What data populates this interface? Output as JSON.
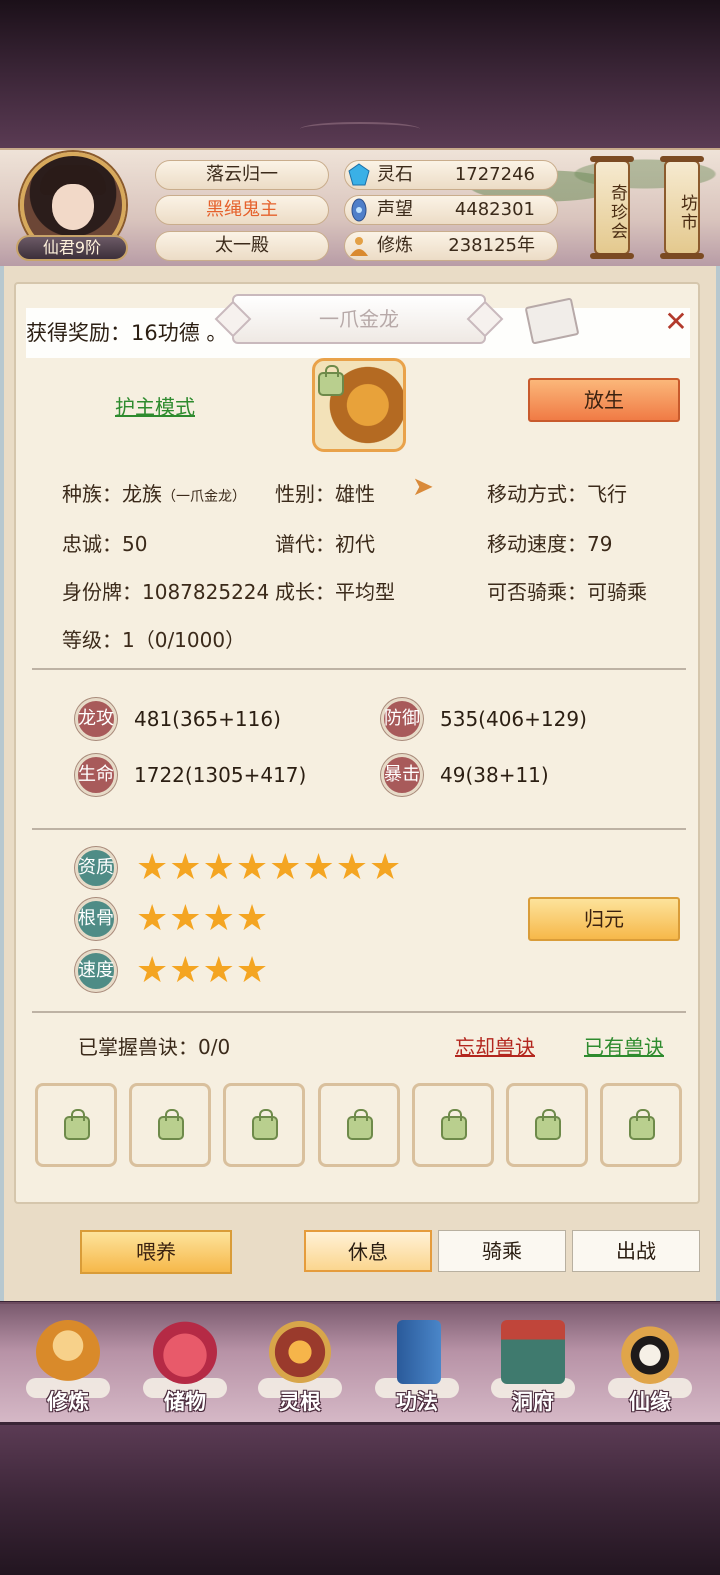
{
  "header": {
    "rank_badge": "仙君9阶",
    "names": [
      "落云归一",
      "黑绳鬼主",
      "太一殿"
    ],
    "resources": [
      {
        "icon": "spirit-stone-icon",
        "label": "灵石",
        "value": "1727246"
      },
      {
        "icon": "prestige-icon",
        "label": "声望",
        "value": "4482301"
      },
      {
        "icon": "cultivation-icon",
        "label": "修炼",
        "value": "238125年"
      }
    ],
    "scroll_buttons": [
      "奇珍会",
      "坊市"
    ]
  },
  "panel": {
    "title": "一爪金龙",
    "reward_text": "获得奖励：16功德 。",
    "guard_mode": "护主模式",
    "release_button": "放生",
    "info": {
      "race_label": "种族：",
      "race_value": "龙族",
      "race_sub": "（一爪金龙）",
      "gender": "性别：雄性",
      "move_mode": "移动方式：飞行",
      "loyalty": "忠诚：50",
      "generation": "谱代：初代",
      "move_speed": "移动速度：79",
      "id_card": "身份牌：1087825224",
      "growth": "成长：平均型",
      "rideable": "可否骑乘：可骑乘",
      "level": "等级：1（0/1000）"
    },
    "stats": [
      {
        "icon_label": "龙攻",
        "value": "481(365+116)"
      },
      {
        "icon_label": "防御",
        "value": "535(406+129)"
      },
      {
        "icon_label": "生命",
        "value": "1722(1305+417)"
      },
      {
        "icon_label": "暴击",
        "value": "49(38+11)"
      }
    ],
    "qualities": [
      {
        "label": "资质",
        "stars": 8
      },
      {
        "label": "根骨",
        "stars": 4
      },
      {
        "label": "速度",
        "stars": 4
      }
    ],
    "reset_button": "归元",
    "skills_mastered": "已掌握兽诀：0/0",
    "forget_skill": "忘却兽诀",
    "owned_skills": "已有兽诀"
  },
  "actions": {
    "feed": "喂养",
    "modes": [
      "休息",
      "骑乘",
      "出战"
    ],
    "active_mode": "休息"
  },
  "nav": [
    "修炼",
    "储物",
    "灵根",
    "功法",
    "洞府",
    "仙缘"
  ],
  "colors": {
    "accent_orange": "#f07b45",
    "gold": "#f6b84a",
    "link_green": "#2e8b2e",
    "link_red": "#b3261e",
    "star": "#f4a522"
  }
}
